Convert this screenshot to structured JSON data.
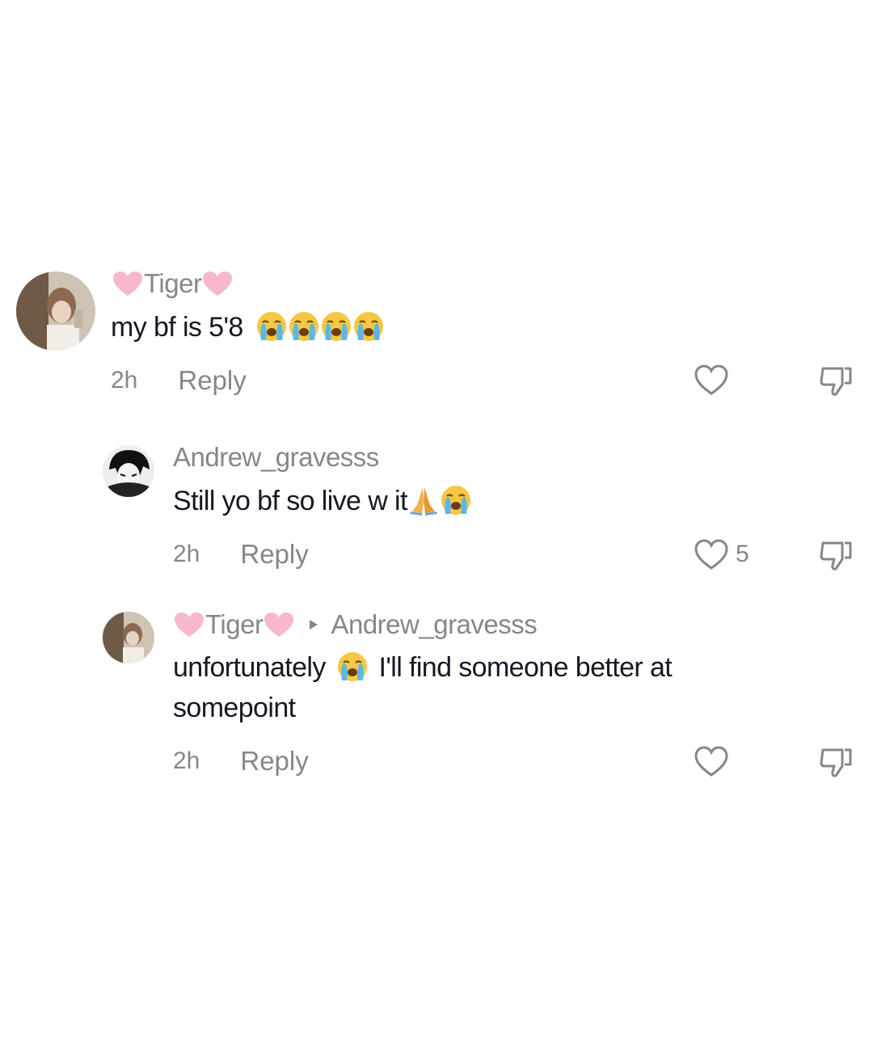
{
  "comments": [
    {
      "username": "Tiger",
      "text": "my bf is 5'8",
      "time": "2h",
      "reply_label": "Reply",
      "like_count": ""
    },
    {
      "username": "Andrew_gravesss",
      "text": "Still yo bf so live w it",
      "time": "2h",
      "reply_label": "Reply",
      "like_count": "5"
    },
    {
      "username": "Tiger",
      "reply_to": "Andrew_gravesss",
      "text_part1": "unfortunately",
      "text_part2": "I'll find someone better at",
      "text_line2": "somepoint",
      "time": "2h",
      "reply_label": "Reply",
      "like_count": ""
    }
  ],
  "colors": {
    "secondary_text": "#86878b",
    "primary_text": "#161823",
    "pink_heart": "#f7b8cf"
  },
  "icons": {
    "like": "heart-outline-icon",
    "dislike": "thumbs-down-icon",
    "emoji_cry": "loudly-crying-face-icon",
    "emoji_pray": "folded-hands-icon",
    "emoji_heart": "pink-heart-icon"
  }
}
